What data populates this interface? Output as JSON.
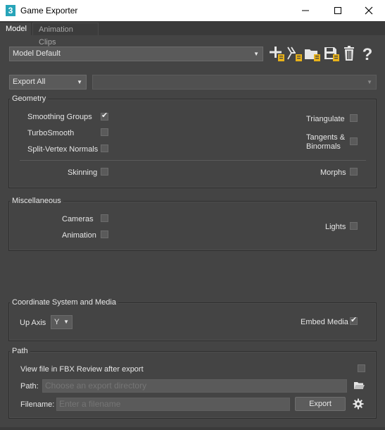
{
  "window": {
    "title": "Game Exporter",
    "app_icon_text": "3",
    "buttons": [
      "minimize-icon",
      "maximize-icon",
      "close-icon"
    ]
  },
  "tabs": [
    {
      "label": "Model",
      "active": true
    },
    {
      "label": "Animation Clips",
      "active": false
    }
  ],
  "preset": {
    "selected": "Model Default",
    "toolbar_icons": [
      "add-preset-icon",
      "add-clip-preset-icon",
      "open-folder-icon",
      "save-icon",
      "delete-icon",
      "help-icon"
    ]
  },
  "export_mode": {
    "selected": "Export All",
    "secondary": ""
  },
  "geometry": {
    "title": "Geometry",
    "smoothing_groups": {
      "label": "Smoothing Groups",
      "checked": true
    },
    "turbosmooth": {
      "label": "TurboSmooth",
      "checked": false
    },
    "split_vertex_normals": {
      "label": "Split-Vertex Normals",
      "checked": false
    },
    "triangulate": {
      "label": "Triangulate",
      "checked": false
    },
    "tangents_binormals": {
      "label_line1": "Tangents &",
      "label_line2": "Binormals",
      "checked": false
    },
    "skinning": {
      "label": "Skinning",
      "checked": false
    },
    "morphs": {
      "label": "Morphs",
      "checked": false
    }
  },
  "miscellaneous": {
    "title": "Miscellaneous",
    "cameras": {
      "label": "Cameras",
      "checked": false
    },
    "animation": {
      "label": "Animation",
      "checked": false
    },
    "lights": {
      "label": "Lights",
      "checked": false
    }
  },
  "coordinate": {
    "title": "Coordinate System and Media",
    "up_axis_label": "Up Axis",
    "up_axis_value": "Y",
    "embed_media": {
      "label": "Embed Media",
      "checked": true
    }
  },
  "path": {
    "title": "Path",
    "view_fbx_review": {
      "label": "View file in FBX Review after export",
      "checked": false
    },
    "path_label": "Path:",
    "path_placeholder": "Choose an export directory",
    "filename_label": "Filename:",
    "filename_placeholder": "Enter a filename",
    "export_button": "Export"
  },
  "colors": {
    "background": "#444444",
    "titlebar": "#ffffff",
    "field": "#5a5a5a",
    "accent_folder": "#e8b21a",
    "app_icon": "#27a4b9"
  }
}
